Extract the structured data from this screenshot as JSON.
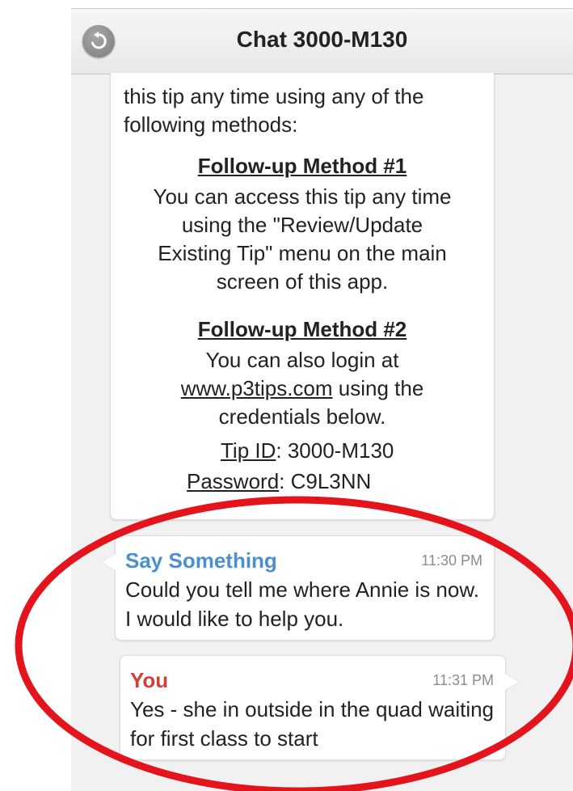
{
  "header": {
    "title": "Chat 3000-M130",
    "back_icon": "back-arrow-icon"
  },
  "tip_message": {
    "intro": "this tip any time using any of the following methods:",
    "method1_heading": "Follow-up Method #1",
    "method1_line1": "You can access this tip any time",
    "method1_line2": "using the \"Review/Update",
    "method1_line3": "Existing Tip\" menu on the main",
    "method1_line4": "screen of this app.",
    "method2_heading": "Follow-up Method #2",
    "method2_line1": "You can also login at",
    "method2_link": "www.p3tips.com",
    "method2_link_suffix": " using the",
    "method2_line3": "credentials below.",
    "tip_id_label": "Tip ID",
    "tip_id_value": ": 3000-M130",
    "password_label": "Password",
    "password_value": ": C9L3NN"
  },
  "messages": [
    {
      "sender": "Say Something",
      "time": "11:30 PM",
      "text": "Could you tell me where Annie is now. I would like to help you."
    },
    {
      "sender": "You",
      "time": "11:31 PM",
      "text": "Yes - she in outside in the quad waiting for first class to start"
    }
  ],
  "colors": {
    "sender_other": "#4a8fd0",
    "sender_you": "#d0403a",
    "annotation_circle": "#e3141b"
  }
}
